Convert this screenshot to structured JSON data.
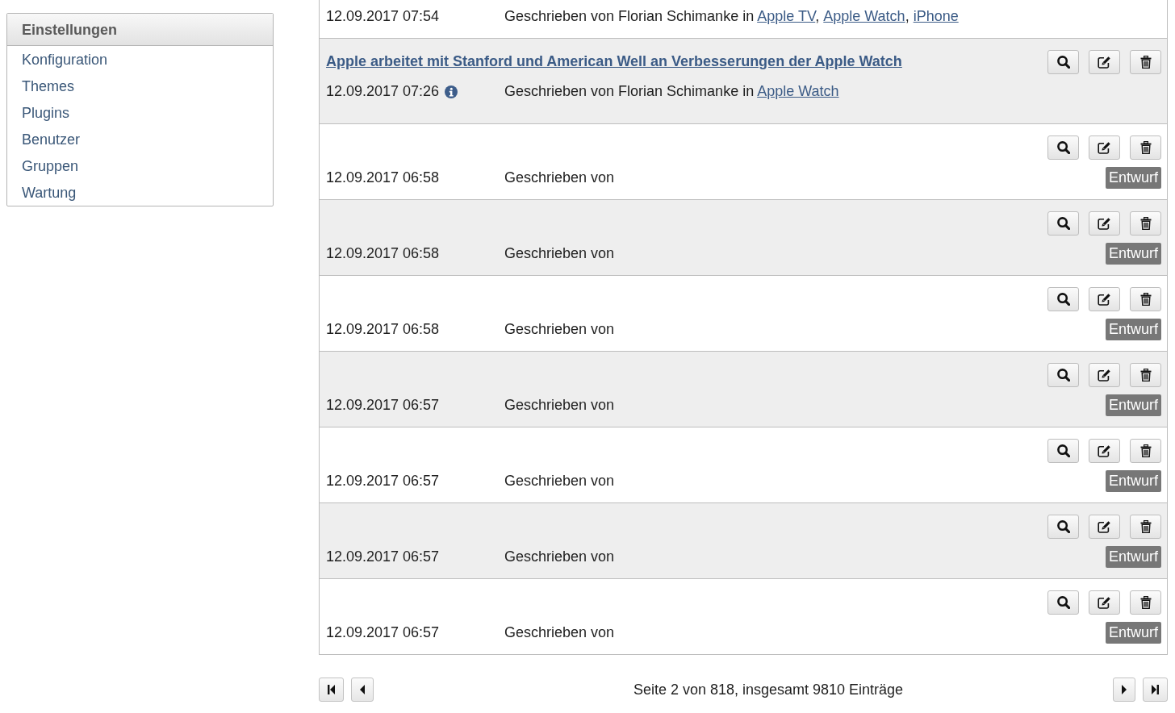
{
  "sidebar": {
    "title": "Einstellungen",
    "items": [
      {
        "label": "Konfiguration"
      },
      {
        "label": "Themes"
      },
      {
        "label": "Plugins"
      },
      {
        "label": "Benutzer"
      },
      {
        "label": "Gruppen"
      },
      {
        "label": "Wartung"
      }
    ]
  },
  "posts": [
    {
      "date": "12.09.2017 07:54",
      "byline": "Geschrieben von Florian Schimanke in",
      "categories": [
        {
          "name": "Apple TV",
          "suffix": ","
        },
        {
          "name": "Apple Watch",
          "suffix": ","
        },
        {
          "name": "iPhone"
        }
      ]
    },
    {
      "title": "Apple arbeitet mit Stanford und American Well an Verbesserungen der Apple Watch",
      "actions": [
        {
          "kind": "view"
        },
        {
          "kind": "edit"
        },
        {
          "kind": "delete"
        }
      ],
      "date": "12.09.2017 07:26",
      "info": true,
      "byline": "Geschrieben von Florian Schimanke in",
      "categories": [
        {
          "name": "Apple Watch"
        }
      ]
    },
    {
      "actions": [
        {
          "kind": "view"
        },
        {
          "kind": "edit"
        },
        {
          "kind": "delete"
        }
      ],
      "date": "12.09.2017 06:58",
      "byline": "Geschrieben von",
      "badge": "Entwurf"
    },
    {
      "actions": [
        {
          "kind": "view"
        },
        {
          "kind": "edit"
        },
        {
          "kind": "delete"
        }
      ],
      "date": "12.09.2017 06:58",
      "byline": "Geschrieben von",
      "badge": "Entwurf"
    },
    {
      "actions": [
        {
          "kind": "view"
        },
        {
          "kind": "edit"
        },
        {
          "kind": "delete"
        }
      ],
      "date": "12.09.2017 06:58",
      "byline": "Geschrieben von",
      "badge": "Entwurf"
    },
    {
      "actions": [
        {
          "kind": "view"
        },
        {
          "kind": "edit"
        },
        {
          "kind": "delete"
        }
      ],
      "date": "12.09.2017 06:57",
      "byline": "Geschrieben von",
      "badge": "Entwurf"
    },
    {
      "actions": [
        {
          "kind": "view"
        },
        {
          "kind": "edit"
        },
        {
          "kind": "delete"
        }
      ],
      "date": "12.09.2017 06:57",
      "byline": "Geschrieben von",
      "badge": "Entwurf"
    },
    {
      "actions": [
        {
          "kind": "view"
        },
        {
          "kind": "edit"
        },
        {
          "kind": "delete"
        }
      ],
      "date": "12.09.2017 06:57",
      "byline": "Geschrieben von",
      "badge": "Entwurf"
    },
    {
      "actions": [
        {
          "kind": "view"
        },
        {
          "kind": "edit"
        },
        {
          "kind": "delete"
        }
      ],
      "date": "12.09.2017 06:57",
      "byline": "Geschrieben von",
      "badge": "Entwurf"
    }
  ],
  "pagination": {
    "left": [
      {
        "kind": "first"
      },
      {
        "kind": "previous"
      }
    ],
    "summary": "Seite 2 von 818, insgesamt 9810 Einträge",
    "right": [
      {
        "kind": "next"
      },
      {
        "kind": "last"
      }
    ]
  }
}
